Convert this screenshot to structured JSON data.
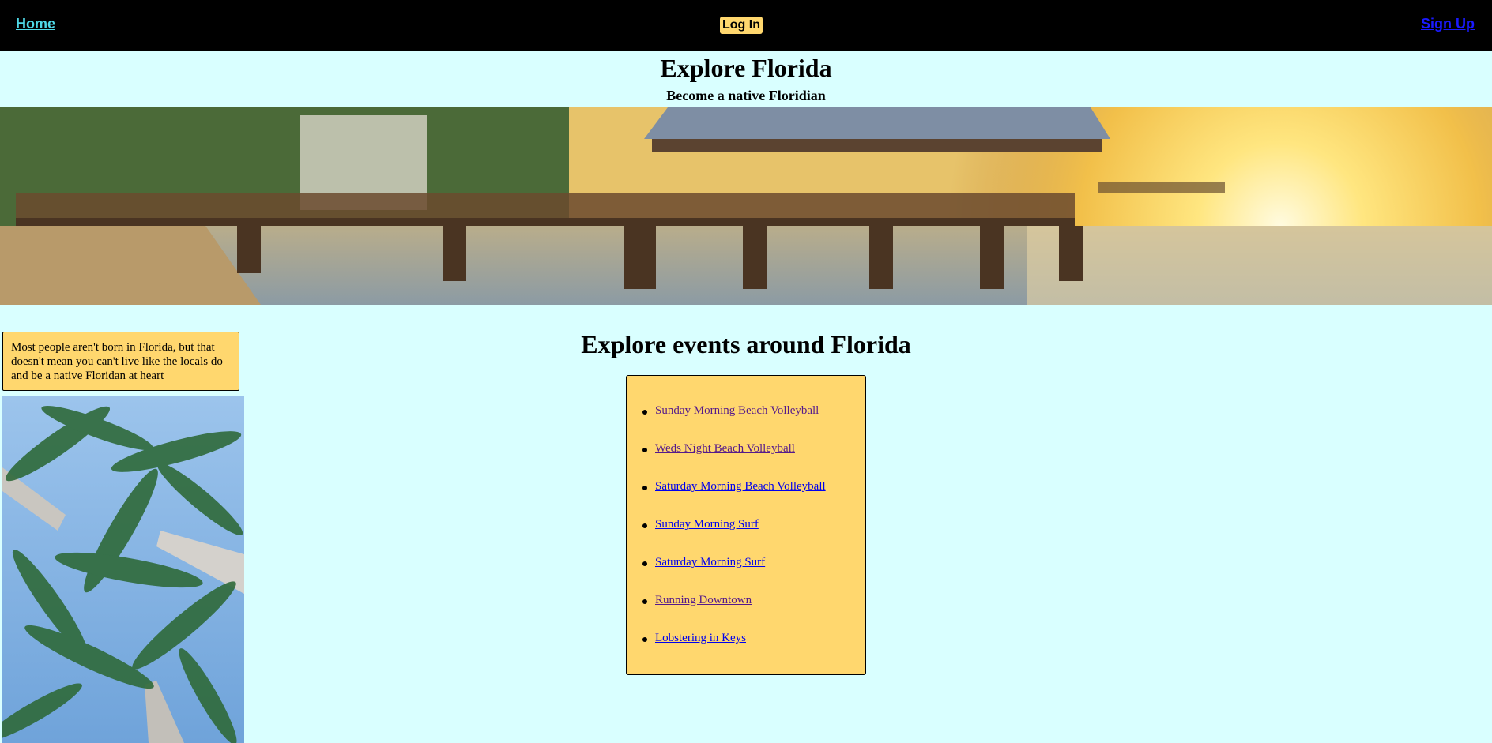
{
  "nav": {
    "home": "Home",
    "login": "Log In",
    "signup": "Sign Up"
  },
  "header": {
    "title": "Explore Florida",
    "subtitle": "Become a native Floridian"
  },
  "intro": {
    "text": "Most people aren't born in Florida, but that doesn't mean you can't live like the locals do and be a native Floridan at heart"
  },
  "events": {
    "title": "Explore events around Florida",
    "items": [
      {
        "label": "Sunday Morning Beach Volleyball",
        "visited": true
      },
      {
        "label": "Weds Night Beach Volleyball",
        "visited": true
      },
      {
        "label": "Saturday Morning Beach Volleyball",
        "visited": false
      },
      {
        "label": "Sunday Morning Surf",
        "visited": false
      },
      {
        "label": "Saturday Morning Surf",
        "visited": false
      },
      {
        "label": "Running Downtown",
        "visited": true
      },
      {
        "label": "Lobstering in Keys",
        "visited": false
      }
    ]
  },
  "colors": {
    "page_bg": "#d9ffff",
    "nav_bg": "#000000",
    "accent": "#ffd76e",
    "home_link": "#4fd8e6",
    "link": "#0000ee",
    "visited_link": "#551a8b"
  }
}
